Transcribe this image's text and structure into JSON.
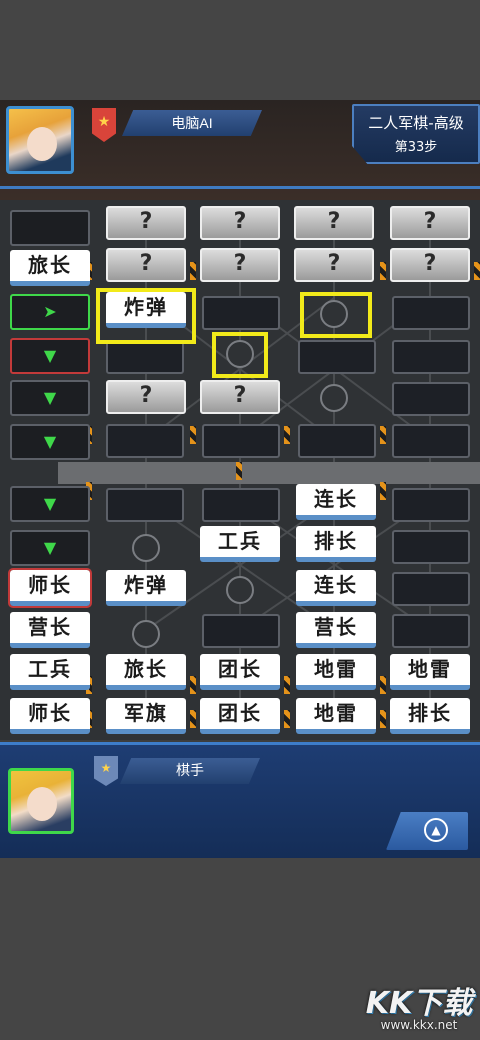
{
  "header": {
    "opponent_name": "电脑AI",
    "mode_title": "二人军棋-高级",
    "step_label": "第33步",
    "rank_icon": "star-chevron-badge"
  },
  "player": {
    "name": "棋手",
    "nav_icon": "navigation-arrow-icon"
  },
  "board": {
    "unknown_mark": "?",
    "left_column": {
      "row2": "旅长",
      "row3_arrow": "➤",
      "row4_arrow": "▼",
      "row5_arrow": "▼",
      "row6_arrow": "▼",
      "row7_arrow": "▼",
      "row8_arrow": "▼",
      "row9": "师长",
      "row10": "营长",
      "row11": "工兵",
      "row12": "师长"
    },
    "pieces": {
      "r3c2": "炸弹",
      "r7c4": "连长",
      "r8c3": "工兵",
      "r8c4": "排长",
      "r9c2": "炸弹",
      "r9c4": "连长",
      "r10c4": "营长",
      "r11c2": "旅长",
      "r11c3": "团长",
      "r11c4": "地雷",
      "r11c5": "地雷",
      "r12c2": "军旗",
      "r12c3": "团长",
      "r12c4": "地雷",
      "r12c5": "排长"
    }
  },
  "colors": {
    "highlight": "#f2ea1a",
    "accent_blue": "#3e7dc9",
    "active_green": "#3fd84a"
  },
  "watermark": {
    "logo": "KK下载",
    "url": "www.kkx.net"
  }
}
